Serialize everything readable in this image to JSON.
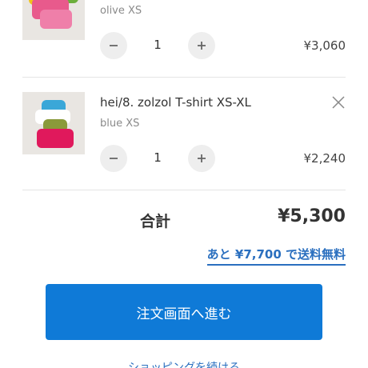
{
  "cart": {
    "items": [
      {
        "title": "",
        "variant": "olive XS",
        "quantity": "1",
        "price": "¥3,060"
      },
      {
        "title": "hei/8. zolzol T-shirt XS-XL",
        "variant": "blue XS",
        "quantity": "1",
        "price": "¥2,240"
      }
    ]
  },
  "summary": {
    "total_label": "合計",
    "total_value": "¥5,300",
    "free_shipping_text": "あと ¥7,700 で送料無料"
  },
  "actions": {
    "checkout_label": "注文画面へ進む",
    "continue_label": "ショッピングを続ける"
  },
  "colors": {
    "accent": "#0f7ad7",
    "link": "#2a6fbf",
    "stepper_bg": "#eeeeee"
  }
}
